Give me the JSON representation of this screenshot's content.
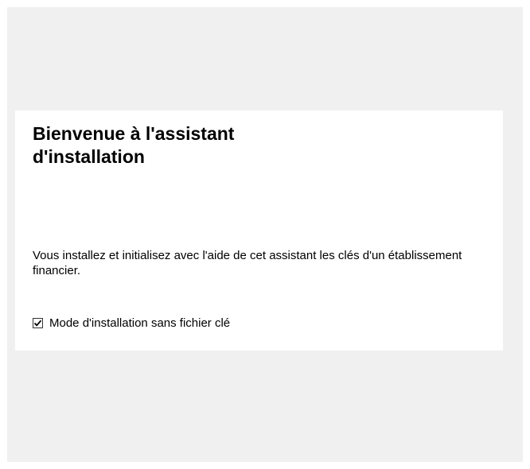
{
  "wizard": {
    "title": "Bienvenue à l'assistant d'installation",
    "description": "Vous installez et initialisez avec l'aide de cet assistant les clés d'un établissement financier.",
    "keyless_mode": {
      "label": "Mode d'installation sans fichier clé",
      "checked": true
    }
  },
  "colors": {
    "window_background": "#f0f0f0",
    "panel_background": "#ffffff",
    "text": "#000000"
  },
  "icons": {
    "checkmark": "checkmark-icon"
  }
}
